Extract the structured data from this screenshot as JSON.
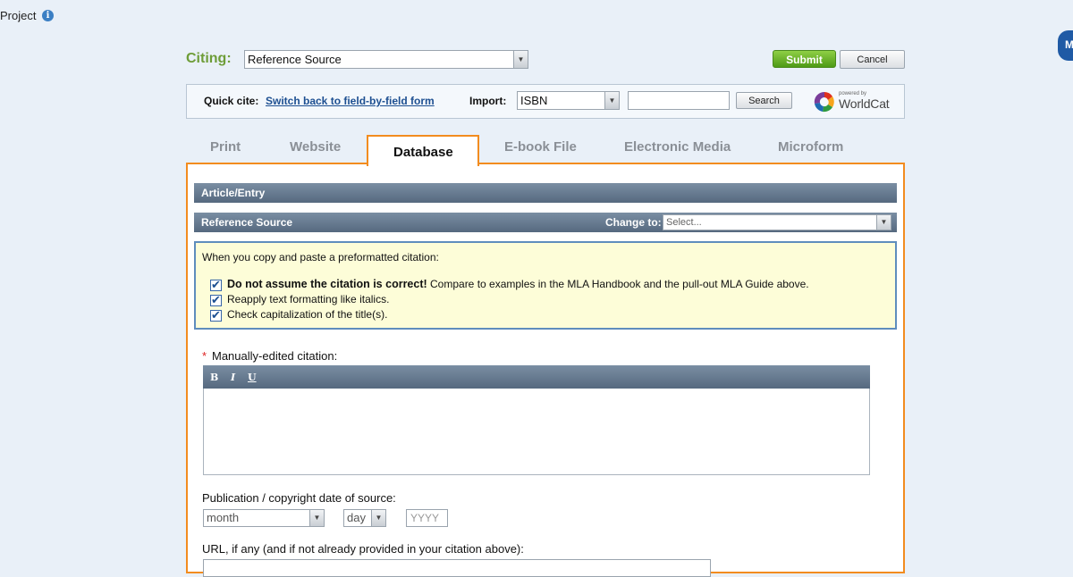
{
  "header": {
    "project_label": "Project",
    "info_icon": "i",
    "badge_text": "M"
  },
  "citing": {
    "label": "Citing:",
    "selected": "Reference Source",
    "submit_label": "Submit",
    "cancel_label": "Cancel"
  },
  "quick_cite": {
    "label": "Quick cite:",
    "switch_link": "Switch back to field-by-field form",
    "import_label": "Import:",
    "import_selected": "ISBN",
    "import_value": "",
    "search_label": "Search",
    "logo_powered": "powered by",
    "logo_text": "WorldCat"
  },
  "tabs": [
    {
      "label": "Print",
      "active": false
    },
    {
      "label": "Website",
      "active": false
    },
    {
      "label": "Database",
      "active": true
    },
    {
      "label": "E-book File",
      "active": false
    },
    {
      "label": "Electronic Media",
      "active": false
    },
    {
      "label": "Microform",
      "active": false
    }
  ],
  "panel": {
    "section_bar": "Article/Entry",
    "source_bar": "Reference Source",
    "change_to_label": "Change to:",
    "change_to_placeholder": "Select..."
  },
  "notice": {
    "intro": "When you copy and paste a preformatted citation:",
    "item1_bold": "Do not assume the citation is correct!",
    "item1_rest": " Compare to examples in the MLA Handbook and the pull-out MLA Guide above.",
    "item2": "Reapply text formatting like italics.",
    "item3": "Check capitalization of the title(s).",
    "check_glyph": "✔"
  },
  "citation_field": {
    "required_mark": "*",
    "label": "Manually-edited citation:",
    "toolbar": {
      "bold": "B",
      "italic": "I",
      "underline": "U"
    },
    "value": ""
  },
  "pub_date": {
    "label": "Publication / copyright date of source:",
    "month_placeholder": "month",
    "day_placeholder": "day",
    "year_placeholder": "YYYY"
  },
  "url_field": {
    "label": "URL, if any (and if not already provided in your citation above):",
    "value": ""
  },
  "colors": {
    "accent_orange": "#f28c1f",
    "submit_green": "#6ab82c",
    "header_bar": "#5e7287",
    "notice_bg": "#fdfdd8",
    "link_blue": "#1d4f91"
  }
}
